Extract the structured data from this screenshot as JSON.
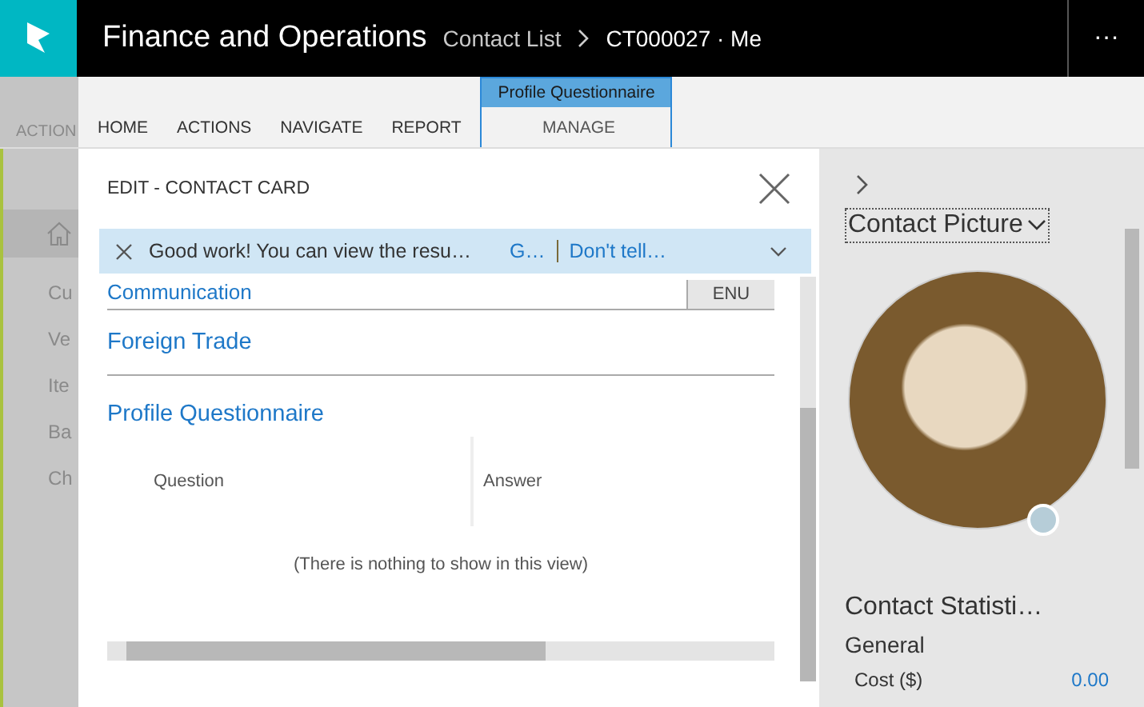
{
  "app_bar": {
    "title": "Finance and Operations",
    "breadcrumb": [
      {
        "label": "Contact List"
      },
      {
        "label": "CT000027 · Me"
      }
    ],
    "more": "···"
  },
  "background": {
    "ribbon_tab": "ACTION",
    "nav_items": [
      "Cu",
      "Ve",
      "Ite",
      "Ba",
      "Ch"
    ]
  },
  "ribbon": {
    "tabs": [
      {
        "label": "HOME",
        "selected": false
      },
      {
        "label": "ACTIONS",
        "selected": false
      },
      {
        "label": "NAVIGATE",
        "selected": false
      },
      {
        "label": "REPORT",
        "selected": false
      }
    ],
    "context_group": {
      "label": "Profile Questionnaire",
      "tabs": [
        {
          "label": "MANAGE",
          "selected": false
        }
      ]
    }
  },
  "dialog": {
    "title": "EDIT - CONTACT CARD",
    "message_bar": {
      "text": "Good work! You can view the resu…",
      "links": [
        "G…",
        "Don't tell…"
      ]
    },
    "sections": [
      {
        "kind": "value",
        "title": "Communication",
        "value": "ENU"
      },
      {
        "kind": "header",
        "title": "Foreign Trade"
      },
      {
        "kind": "grid",
        "title": "Profile Questionnaire",
        "columns": [
          "Question",
          "Answer"
        ],
        "empty_text": "(There is nothing to show in this view)"
      }
    ]
  },
  "side_panel": {
    "picture_title": "Contact Picture",
    "statistics": {
      "title": "Contact Statisti…",
      "group": "General",
      "rows": [
        {
          "label": "Cost ($)",
          "value": "0.00"
        }
      ]
    }
  }
}
